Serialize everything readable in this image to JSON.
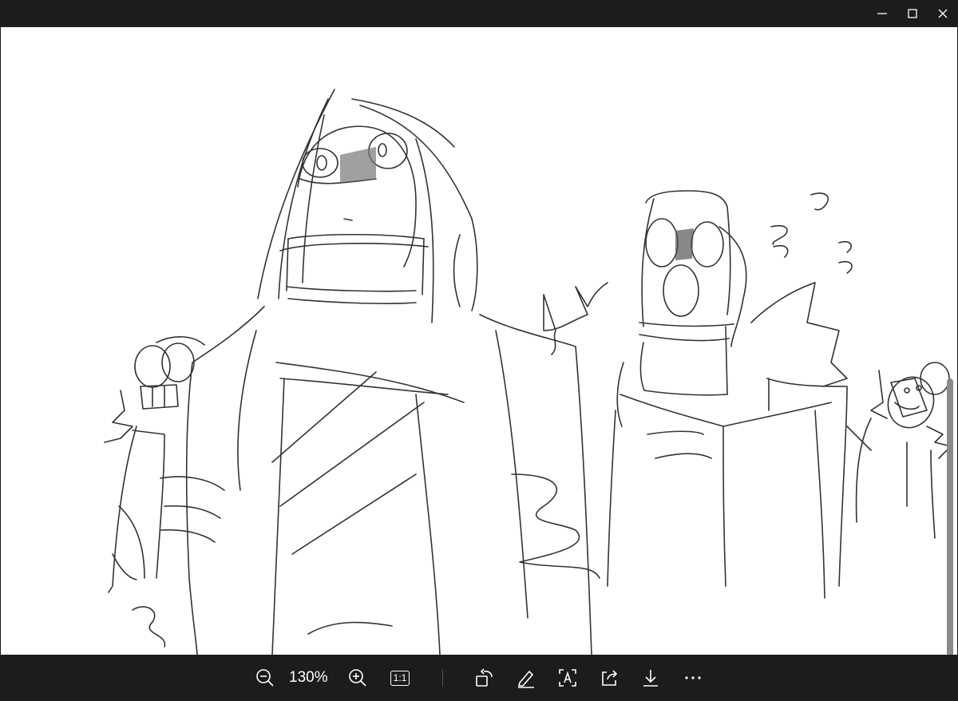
{
  "window": {
    "minimize_icon": "minimize-icon",
    "maximize_icon": "maximize-icon",
    "close_icon": "close-icon"
  },
  "toolbar": {
    "zoom_level": "130%",
    "actual_size_label": "1:1",
    "icons": [
      "zoom-out-icon",
      "zoom-in-icon",
      "actual-size-icon",
      "rotate-icon",
      "edit-icon",
      "text-recognition-icon",
      "share-icon",
      "save-icon",
      "more-icon"
    ]
  },
  "colors": {
    "chrome": "#1c1c1c",
    "canvas": "#ffffff",
    "scrollbar": "#8a8a8a"
  }
}
